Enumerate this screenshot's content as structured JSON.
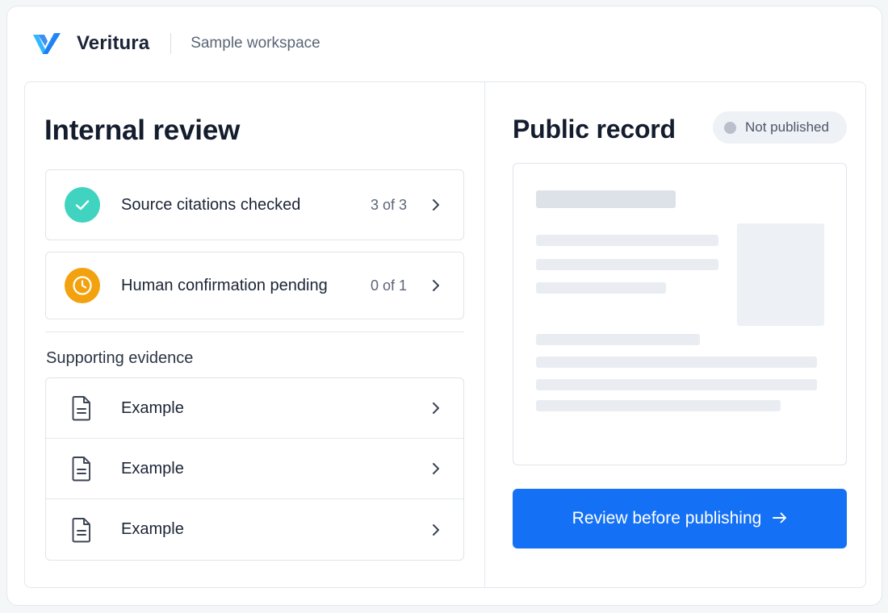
{
  "app": {
    "brand": "Veritura",
    "workspace": "Sample workspace",
    "logo_icon": "veritura-logo-icon"
  },
  "colors": {
    "accent": "#1471f5",
    "success": "#3fd3c0",
    "warning": "#f2a20f",
    "neutral_dot": "#b9c0cb"
  },
  "internal_review": {
    "title": "Internal review",
    "items": [
      {
        "label": "Source citations checked",
        "count": "3 of 3",
        "status": "complete",
        "icon": "check-circle-icon"
      },
      {
        "label": "Human confirmation pending",
        "count": "0 of 1",
        "status": "pending",
        "icon": "clock-icon"
      }
    ],
    "evidence_title": "Supporting evidence",
    "evidence": [
      {
        "label": "Example",
        "icon": "document-icon"
      },
      {
        "label": "Example",
        "icon": "document-icon"
      },
      {
        "label": "Example",
        "icon": "document-icon"
      }
    ]
  },
  "public_record": {
    "title": "Public record",
    "status_badge": "Not published",
    "publish_button": "Review before publishing",
    "publish_icon": "arrow-right-icon"
  }
}
